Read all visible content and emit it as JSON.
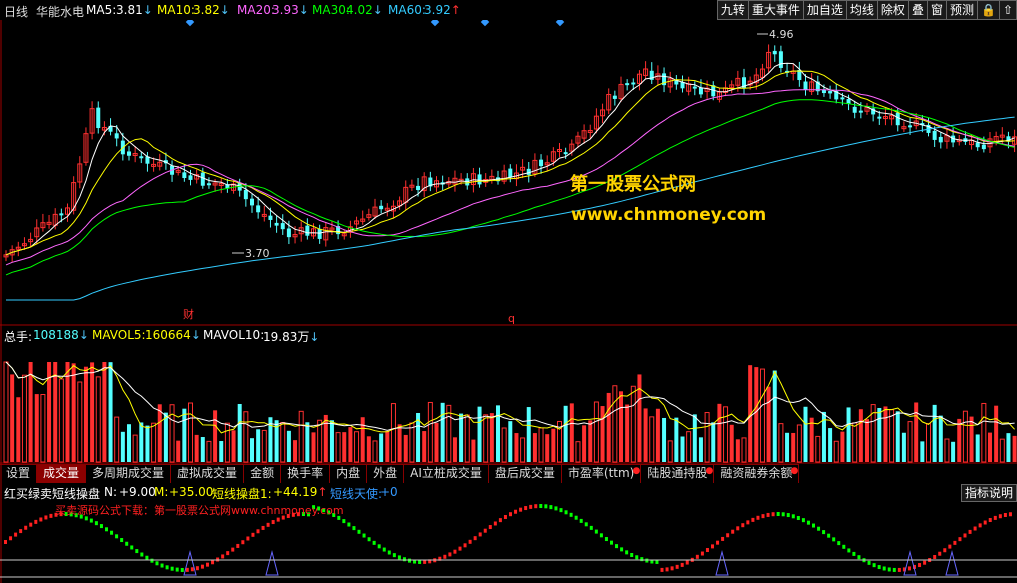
{
  "header": {
    "period": "日线",
    "stock": "华能水电",
    "ma5_label": "MA5:",
    "ma5_value": "3.81",
    "ma10_label": "MA10:",
    "ma10_value": "3.82",
    "ma20_label": "MA20:",
    "ma20_value": "3.93",
    "ma30_label": "MA30:",
    "ma30_value": "4.02",
    "ma60_label": "MA60:",
    "ma60_value": "3.92"
  },
  "toolbar": [
    "九转",
    "重大事件",
    "加自选",
    "均线",
    "除权",
    "叠",
    "窗",
    "预测",
    "🔒",
    "⇧"
  ],
  "price_chart": {
    "high_label": "4.96",
    "low_label": "3.70",
    "marker_cai": "财",
    "marker_q": "q"
  },
  "watermark": {
    "line1": "第一股票公式网",
    "line2": "www.chnmoney.com"
  },
  "volume": {
    "total_label": "总手:",
    "total_value": "108188",
    "mavol5_label": "MAVOL5:",
    "mavol5_value": "160664",
    "mavol10_label": "MAVOL10:",
    "mavol10_value": "19.83万"
  },
  "tabs": [
    "设置",
    "成交量",
    "多周期成交量",
    "虚拟成交量",
    "金额",
    "换手率",
    "内盘",
    "外盘",
    "AI立桩成交量",
    "盘后成交量",
    "市盈率(ttm)",
    "陆股通持股",
    "融资融券余额"
  ],
  "indicator": {
    "name": "红买绿卖短线操盘",
    "n_label": "N:",
    "n_value": "+9.00",
    "m_label": "M:",
    "m_value": "+35.00",
    "s1_label": "短线操盘1:",
    "s1_value": "+44.19",
    "s2_label": "短线天使:",
    "s2_value": "+0",
    "promo": "买卖源码公式下载：第一股票公式网www.chnmoney.com",
    "explain_button": "指标说明"
  },
  "colors": {
    "up": "#ff3030",
    "down": "#54ffff",
    "ma5": "#ffffff",
    "ma10": "#ffff00",
    "ma20": "#ff66ff",
    "ma30": "#00ff00",
    "ma60": "#33ccff"
  }
}
